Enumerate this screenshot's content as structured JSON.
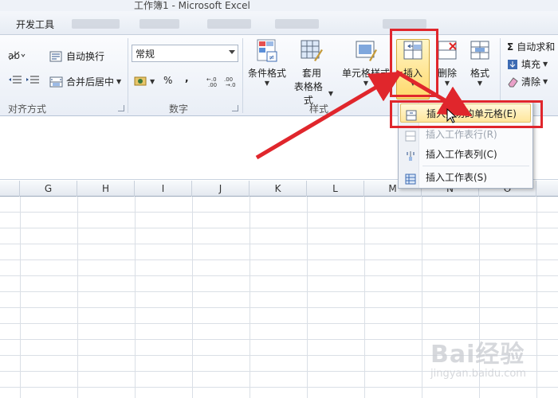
{
  "window": {
    "title": "工作簿1 - Microsoft Excel"
  },
  "tabs": {
    "developer": "开发工具"
  },
  "ribbon": {
    "alignment": {
      "wrap_text": "自动换行",
      "merge_center": "合并后居中",
      "group_label": "对齐方式"
    },
    "number": {
      "format_value": "常规",
      "percent": "%",
      "comma": ",",
      "group_label": "数字"
    },
    "styles": {
      "conditional": "条件格式",
      "format_table_line1": "套用",
      "format_table_line2": "表格格式",
      "cell_styles": "单元格样式",
      "group_label": "样式"
    },
    "cells": {
      "insert": "插入",
      "delete": "删除",
      "format": "格式"
    },
    "editing": {
      "autosum": "自动求和",
      "fill": "填充",
      "clear": "清除"
    }
  },
  "insert_menu": {
    "items": [
      {
        "label": "插入剪切的单元格(E)",
        "state": "hover"
      },
      {
        "label": "插入工作表行(R)",
        "state": "disabled"
      },
      {
        "label": "插入工作表列(C)",
        "state": "normal"
      },
      {
        "label": "插入工作表(S)",
        "state": "normal"
      }
    ]
  },
  "columns": [
    "G",
    "H",
    "I",
    "J",
    "K",
    "L",
    "M",
    "N",
    "O"
  ],
  "watermark": {
    "brand": "Bai经验",
    "url": "jingyan.baidu.com"
  },
  "colors": {
    "annotation_red": "#e0262c",
    "hover_yellow": "#ffe69b"
  }
}
